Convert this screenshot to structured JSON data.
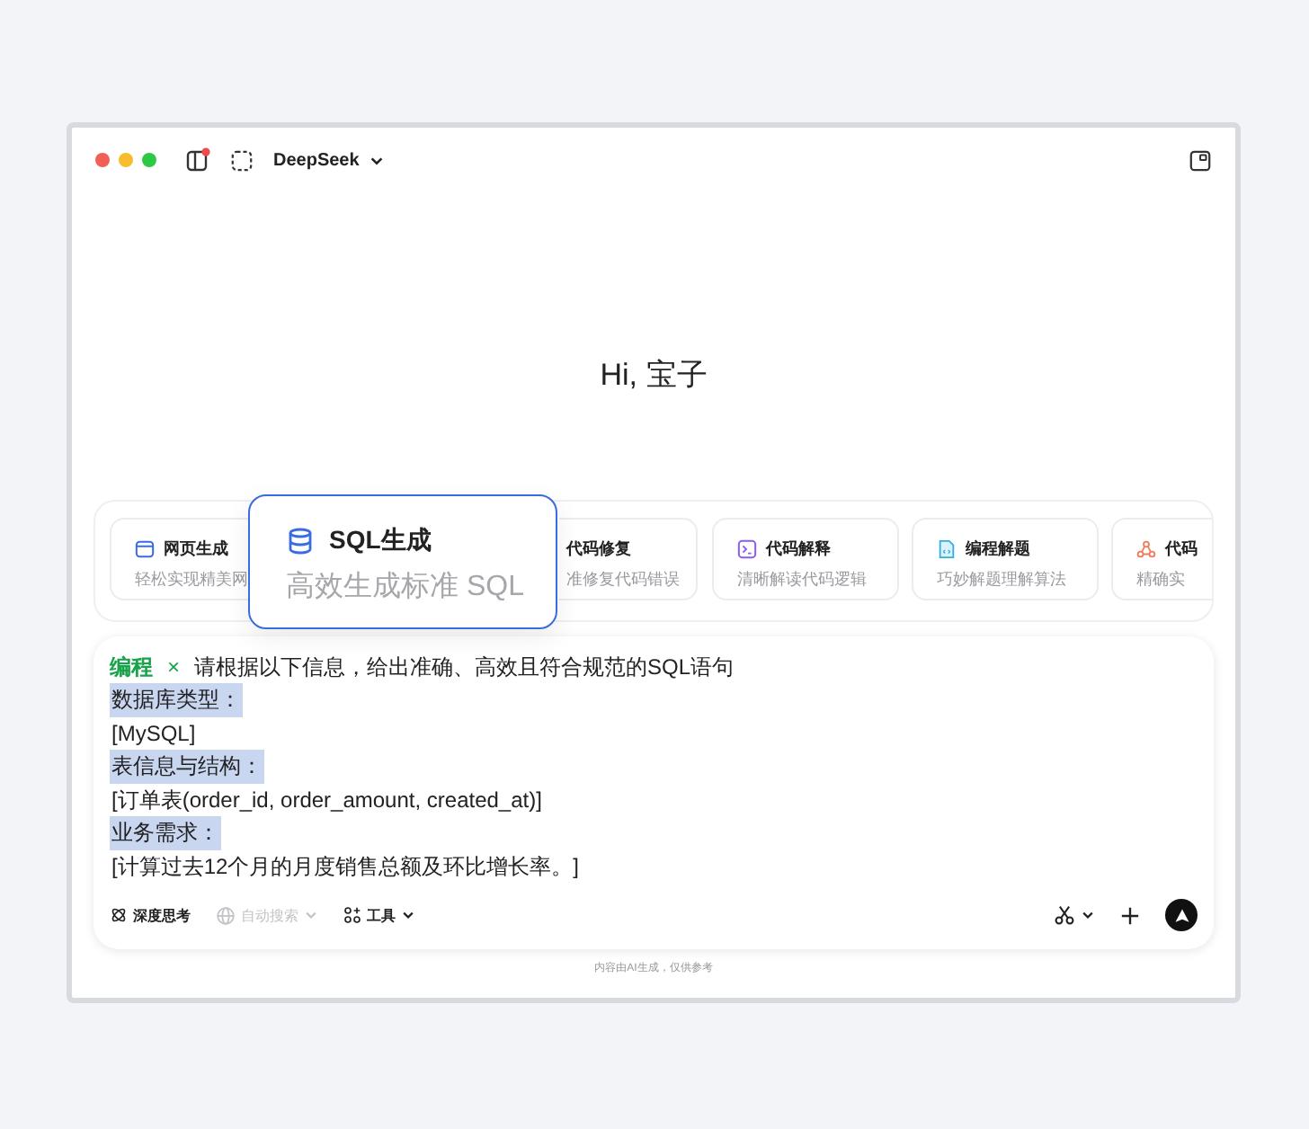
{
  "window": {
    "title": "DeepSeek"
  },
  "greeting": "Hi, 宝子",
  "cards": [
    {
      "kind": "browser",
      "title": "网页生成",
      "desc": "轻松实现精美网"
    },
    {
      "kind": "covered",
      "title": "代码修复",
      "desc": "准修复代码错误"
    },
    {
      "kind": "terminal",
      "title": "代码解释",
      "desc": "清晰解读代码逻辑"
    },
    {
      "kind": "document",
      "title": "编程解题",
      "desc": "巧妙解题理解算法"
    },
    {
      "kind": "network",
      "title": "代码",
      "desc": "精确实"
    }
  ],
  "popup": {
    "title": "SQL生成",
    "desc": "高效生成标准 SQL"
  },
  "prompt": {
    "tag": "编程",
    "remove": "×",
    "text": "请根据以下信息，给出准确、高效且符合规范的SQL语句",
    "lines": [
      {
        "text": "数据库类型：",
        "highlighted": true
      },
      {
        "text": "[MySQL]",
        "highlighted": false
      },
      {
        "text": "表信息与结构：",
        "highlighted": true
      },
      {
        "text": "[订单表(order_id, order_amount, created_at)]",
        "highlighted": false
      },
      {
        "text": "业务需求：",
        "highlighted": true
      },
      {
        "text": "[计算过去12个月的月度销售总额及环比增长率。]",
        "highlighted": false
      }
    ]
  },
  "toolbar": [
    {
      "kind": "think",
      "label": "深度思考",
      "disabled": false,
      "dropdown": false
    },
    {
      "kind": "search",
      "label": "自动搜索",
      "disabled": true,
      "dropdown": true
    },
    {
      "kind": "tools",
      "label": "工具",
      "disabled": false,
      "dropdown": true
    }
  ],
  "footer": "内容由AI生成，仅供参考"
}
